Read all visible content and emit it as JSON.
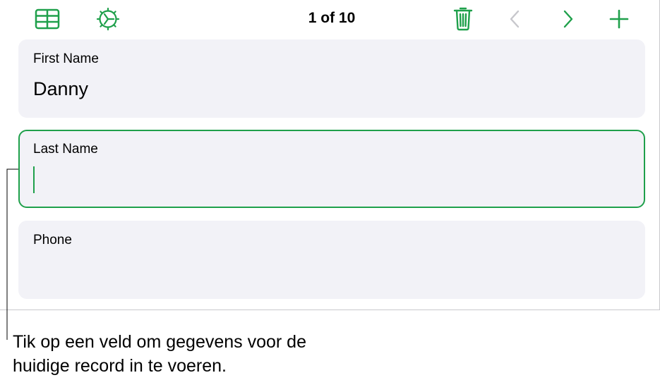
{
  "toolbar": {
    "table_view_icon": "table-grid-icon",
    "settings_icon": "gear-icon",
    "record_counter": "1 of 10",
    "delete_icon": "trash-icon",
    "previous_icon": "chevron-left-icon",
    "next_icon": "chevron-right-icon",
    "add_icon": "plus-icon"
  },
  "fields": [
    {
      "label": "First Name",
      "value": "Danny",
      "active": false
    },
    {
      "label": "Last Name",
      "value": "",
      "active": true
    },
    {
      "label": "Phone",
      "value": "",
      "active": false
    }
  ],
  "callout": {
    "line1": "Tik op een veld om gegevens voor de",
    "line2": "huidige record in te voeren."
  },
  "colors": {
    "accent": "#1fa04b",
    "disabled": "#c7c7cc",
    "card_background": "#f2f2f7",
    "border": "#c8c8cc"
  }
}
